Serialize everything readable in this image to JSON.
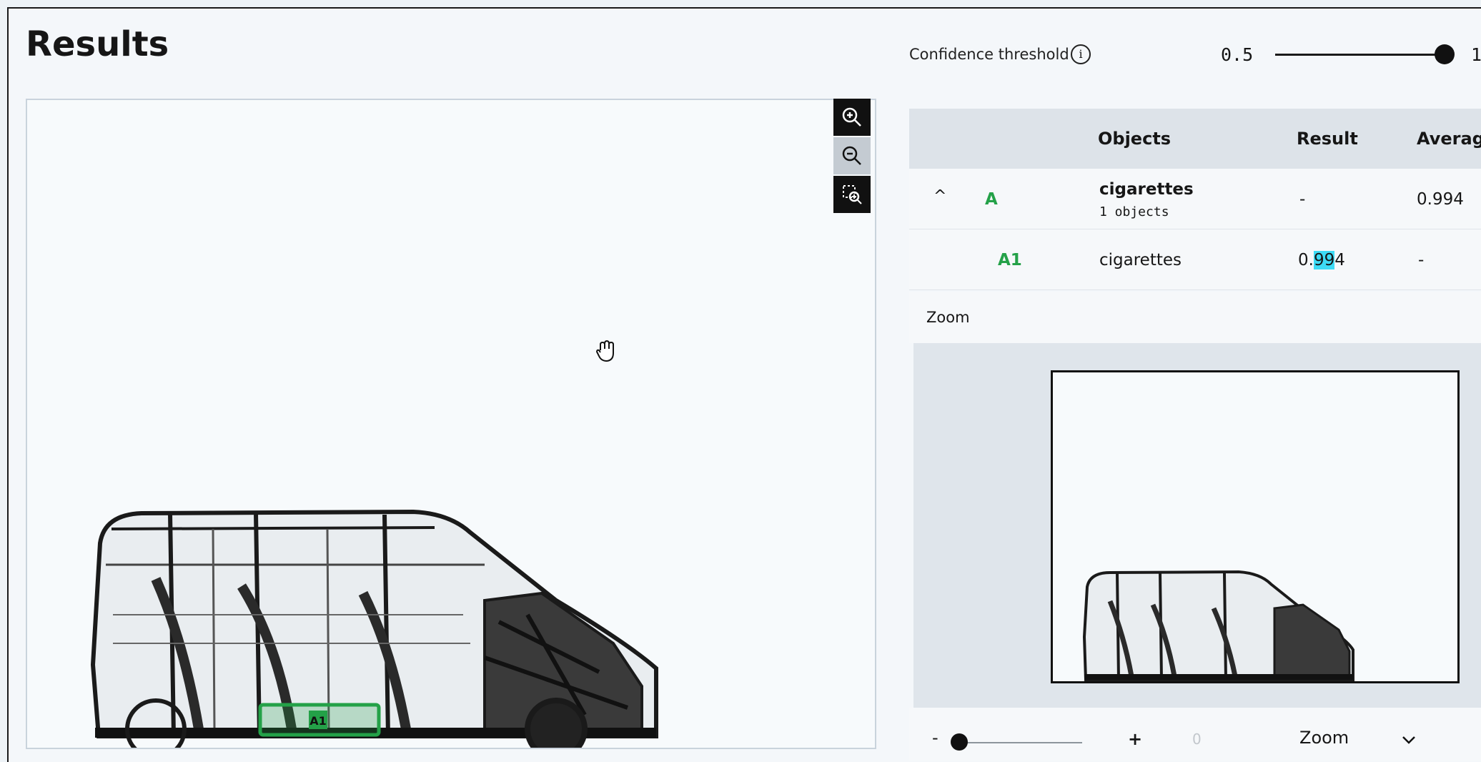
{
  "header": {
    "title": "Results"
  },
  "threshold": {
    "label": "Confidence threshold",
    "min": "0.5",
    "max": "1",
    "value": 1.0
  },
  "viewer": {
    "tools": [
      "zoom-in-icon",
      "zoom-out-icon",
      "zoom-to-selection-icon"
    ],
    "cursor_icon": "hand-grab-icon",
    "detection_label": "A1",
    "detection_color": "#24a148"
  },
  "table": {
    "headers": {
      "objects": "Objects",
      "result": "Result",
      "average": "Average"
    },
    "group": {
      "id": "A",
      "name": "cigarettes",
      "count": "1 objects",
      "result": "-",
      "average": "0.994"
    },
    "item": {
      "id": "A1",
      "name": "cigarettes",
      "result_pre": "0.",
      "result_hl": "99",
      "result_post": "4",
      "average": "-"
    }
  },
  "zoom": {
    "title": "Zoom",
    "minus": "-",
    "plus": "+",
    "value": "0",
    "dropdown": "Zoom",
    "slider_level": 0
  }
}
